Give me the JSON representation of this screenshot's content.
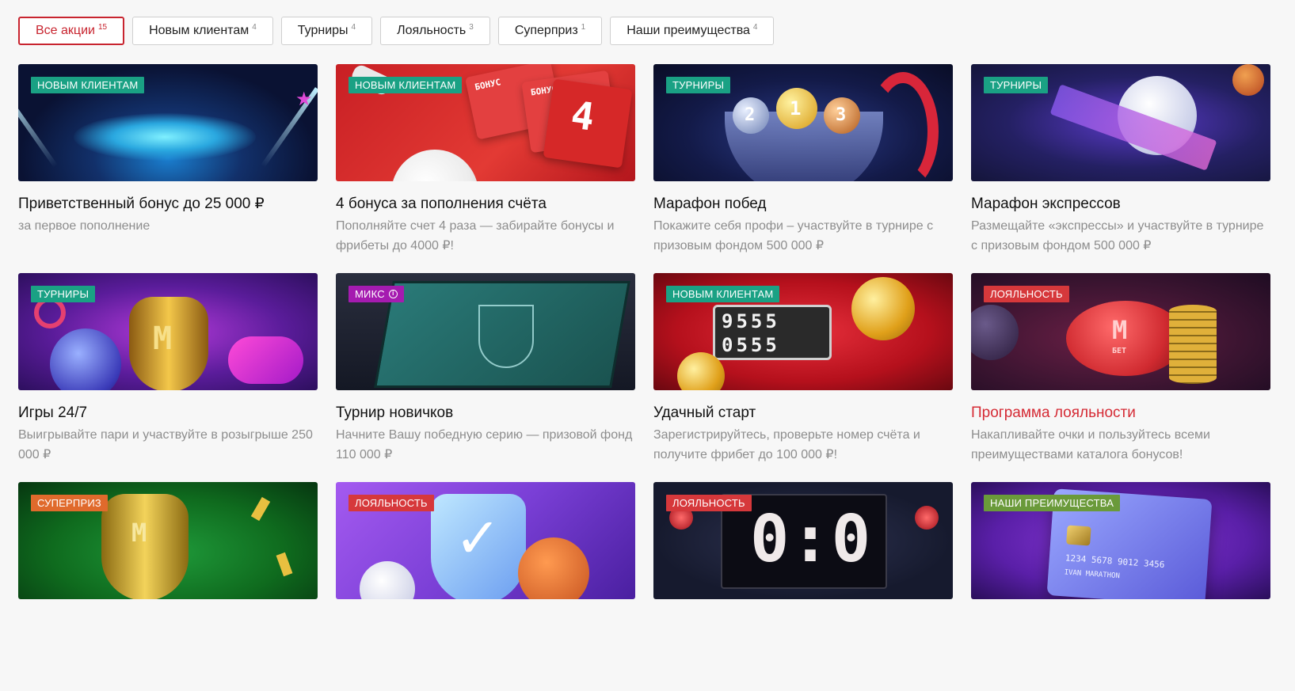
{
  "tabs": [
    {
      "label": "Все акции",
      "count": "15",
      "active": true
    },
    {
      "label": "Новым клиентам",
      "count": "4"
    },
    {
      "label": "Турниры",
      "count": "4"
    },
    {
      "label": "Лояльность",
      "count": "3"
    },
    {
      "label": "Суперприз",
      "count": "1"
    },
    {
      "label": "Наши преимущества",
      "count": "4"
    }
  ],
  "cards": [
    {
      "badge": "НОВЫМ КЛИЕНТАМ",
      "badge_color": "#1aa184",
      "title": "Приветственный бонус до 25 000 ₽",
      "desc": "за первое пополнение",
      "bg": "#0e1a3d"
    },
    {
      "badge": "НОВЫМ КЛИЕНТАМ",
      "badge_color": "#1aa184",
      "title": "4 бонуса за пополнения счёта",
      "desc": "Пополняйте счет 4 раза — забирайте бонусы и фрибеты до 4000 ₽!",
      "bg": "#d42a2a",
      "banner_text": {
        "b1": "БОНУС",
        "b2": "БОНУС",
        "b3": "4"
      }
    },
    {
      "badge": "ТУРНИРЫ",
      "badge_color": "#1aa184",
      "title": "Марафон побед",
      "desc": "Покажите себя профи – участвуйте в турнире с призовым фондом 500 000 ₽",
      "bg": "#101a44",
      "banner_text": {
        "n1": "2",
        "n2": "1",
        "n3": "3"
      }
    },
    {
      "badge": "ТУРНИРЫ",
      "badge_color": "#1aa184",
      "title": "Марафон экспрессов",
      "desc": "Размещайте «экспрессы» и участвуйте в турнире с призовым фондом 500 000 ₽",
      "bg": "#1a1b4a"
    },
    {
      "badge": "ТУРНИРЫ",
      "badge_color": "#1aa184",
      "title": "Игры 24/7",
      "desc": "Выигрывайте пари и участвуйте в розыгрыше 250 000 ₽",
      "bg": "#5a1a8c",
      "banner_text": {
        "m": "M"
      }
    },
    {
      "badge": "МИКС",
      "badge_color": "#a51bb0",
      "badge_info": "i",
      "title": "Турнир новичков",
      "desc": "Начните Вашу победную серию — призовой фонд 110 000 ₽",
      "bg": "#1c2232"
    },
    {
      "badge": "НОВЫМ КЛИЕНТАМ",
      "badge_color": "#1aa184",
      "title": "Удачный старт",
      "desc": "Зарегистрируйтесь, проверьте номер счёта и получите фрибет до 100 000 ₽!",
      "bg": "#c8101c",
      "banner_text": {
        "row1": "9555",
        "row2": "0555"
      }
    },
    {
      "badge": "ЛОЯЛЬНОСТЬ",
      "badge_color": "#d6383b",
      "title": "Программа лояльности",
      "title_red": true,
      "desc": "Накапливайте очки и пользуйтесь всеми преимуществами каталога бонусов!",
      "bg": "#3a1430",
      "banner_text": {
        "m": "M",
        "bet": "БЕТ"
      }
    },
    {
      "badge": "СУПЕРПРИЗ",
      "badge_color": "#e06a2c",
      "title": "",
      "desc": "",
      "bg": "#0f6b1e",
      "banner_text": {
        "m": "M"
      }
    },
    {
      "badge": "ЛОЯЛЬНОСТЬ",
      "badge_color": "#d6383b",
      "title": "",
      "desc": "",
      "bg": "#7a3fd6"
    },
    {
      "badge": "ЛОЯЛЬНОСТЬ",
      "badge_color": "#d6383b",
      "title": "",
      "desc": "",
      "bg": "#161a2e",
      "banner_text": {
        "score": "0:0"
      }
    },
    {
      "badge": "НАШИ ПРЕИМУЩЕСТВА",
      "badge_color": "#6a9a3a",
      "title": "",
      "desc": "",
      "bg": "#6a2ab8",
      "banner_text": {
        "card_num": "1234 5678 9012 3456",
        "card_name": "IVAN MARATHON"
      }
    }
  ]
}
